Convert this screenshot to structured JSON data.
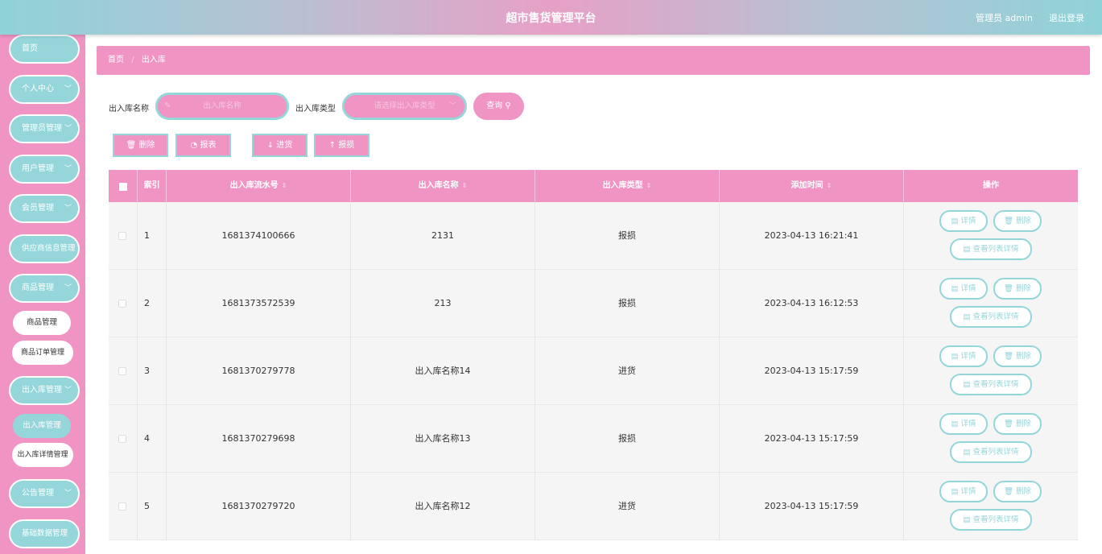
{
  "header": {
    "title": "超市售货管理平台",
    "user": "管理员 admin",
    "logout": "退出登录"
  },
  "sidebar": {
    "items": [
      {
        "label": "首页"
      },
      {
        "label": "个人中心"
      },
      {
        "label": "管理员管理"
      },
      {
        "label": "用户管理"
      },
      {
        "label": "会员管理"
      },
      {
        "label": "供应商信息管理"
      },
      {
        "label": "商品管理"
      },
      {
        "label": "出入库管理"
      },
      {
        "label": "公告管理"
      },
      {
        "label": "基础数据管理"
      }
    ],
    "sub_goods": [
      "商品管理",
      "商品订单管理"
    ],
    "sub_stock": [
      "出入库管理",
      "出入库详情管理"
    ]
  },
  "breadcrumb": {
    "home": "首页",
    "sep": "/",
    "current": "出入库"
  },
  "search": {
    "name_label": "出入库名称",
    "name_placeholder": "出入库名称",
    "type_label": "出入库类型",
    "type_placeholder": "请选择出入库类型",
    "query_label": "查询"
  },
  "actions": {
    "delete": "删除",
    "report": "报表",
    "in": "进货",
    "out": "报损"
  },
  "table": {
    "headers": [
      "索引",
      "出入库流水号",
      "出入库名称",
      "出入库类型",
      "添加时间",
      "操作"
    ],
    "rows": [
      {
        "index": "1",
        "serial": "1681374100666",
        "name": "2131",
        "type": "报损",
        "time": "2023-04-13 16:21:41"
      },
      {
        "index": "2",
        "serial": "1681373572539",
        "name": "213",
        "type": "报损",
        "time": "2023-04-13 16:12:53"
      },
      {
        "index": "3",
        "serial": "1681370279778",
        "name": "出入库名称14",
        "type": "进货",
        "time": "2023-04-13 15:17:59"
      },
      {
        "index": "4",
        "serial": "1681370279698",
        "name": "出入库名称13",
        "type": "报损",
        "time": "2023-04-13 15:17:59"
      },
      {
        "index": "5",
        "serial": "1681370279720",
        "name": "出入库名称12",
        "type": "进货",
        "time": "2023-04-13 15:17:59"
      }
    ],
    "op": {
      "detail": "详情",
      "delete": "删除",
      "list_detail": "查看列表详情"
    }
  },
  "colors": {
    "pink": "#f094c4",
    "teal": "#94d6da"
  }
}
